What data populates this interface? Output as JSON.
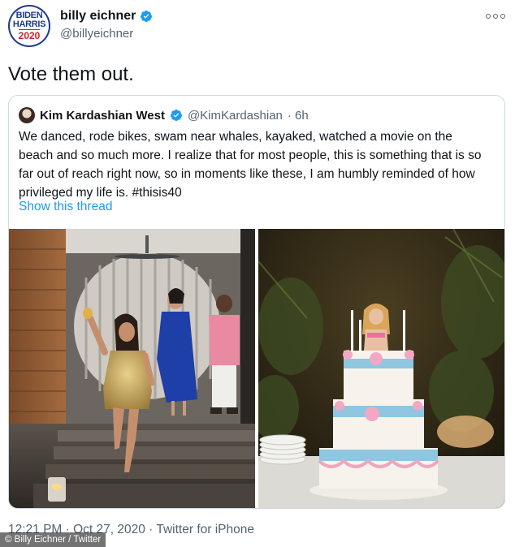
{
  "author": {
    "display_name": "billy eichner",
    "handle": "@billyeichner",
    "avatar_logo": {
      "line1": "BIDEN",
      "line2": "HARRIS",
      "line3": "2020"
    },
    "verified_icon": "verified-badge-icon"
  },
  "tweet": {
    "text": "Vote them out."
  },
  "quoted": {
    "display_name": "Kim Kardashian West",
    "handle": "@KimKardashian",
    "time": "· 6h",
    "body": "We danced, rode bikes, swam near whales, kayaked, watched a movie on the beach and so much more. I realize that for most people, this is something that is so far out of reach right now, so in moments like these, I am humbly reminded of how privileged my life is. #thisis40",
    "thread_link": "Show this thread",
    "images": [
      "party-photo",
      "birthday-cake-photo"
    ]
  },
  "footer": {
    "meta": "12:21 PM · Oct 27, 2020 · Twitter for iPhone"
  },
  "credit": "© Billy Eichner / Twitter",
  "colors": {
    "link": "#1d9bf0",
    "verified": "#1d9bf0",
    "muted": "#536471"
  }
}
